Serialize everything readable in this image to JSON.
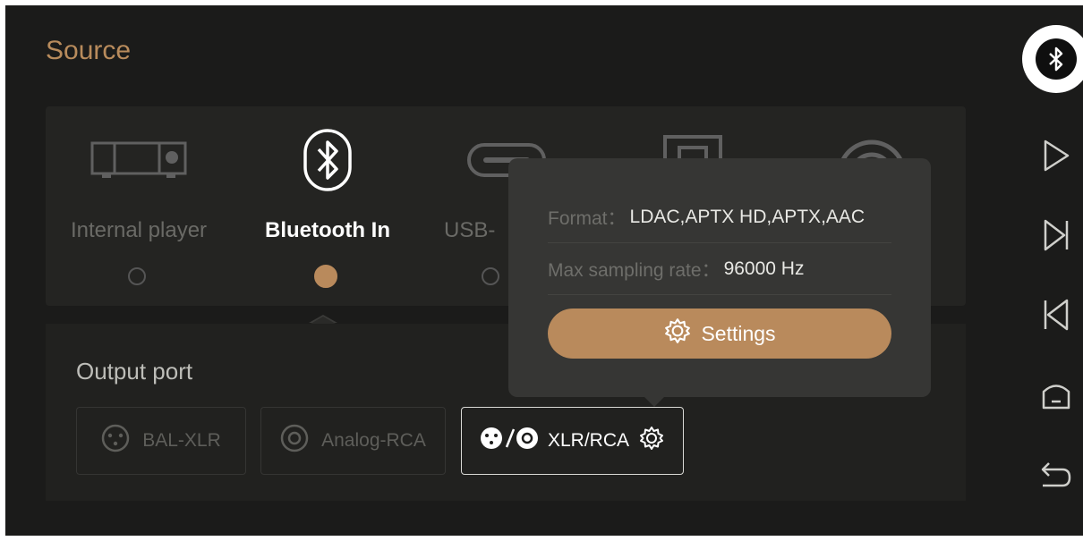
{
  "header": {
    "title": "Source"
  },
  "sources": [
    {
      "label": "Internal player",
      "icon": "player-icon",
      "selected": false
    },
    {
      "label": "Bluetooth In",
      "icon": "bluetooth-icon",
      "selected": true
    },
    {
      "label": "USB-",
      "icon": "usb-c-icon",
      "selected": false
    },
    {
      "label": "",
      "icon": "optical-icon",
      "selected": false
    },
    {
      "label": "",
      "icon": "coaxial-icon",
      "selected": false
    }
  ],
  "output": {
    "title": "Output port",
    "ports": [
      {
        "label": "BAL-XLR",
        "icon": "xlr-icon",
        "selected": false
      },
      {
        "label": "Analog-RCA",
        "icon": "rca-icon",
        "selected": false
      },
      {
        "label": "XLR/RCA",
        "icon": "xlr-rca-icon",
        "selected": true
      }
    ]
  },
  "popup": {
    "format_label": "Format：",
    "format_value": "LDAC,APTX HD,APTX,AAC",
    "rate_label": "Max sampling rate：",
    "rate_value": "96000 Hz",
    "settings_label": "Settings"
  },
  "sidebar": {
    "icons": [
      "bluetooth-icon",
      "play-icon",
      "next-track-icon",
      "previous-track-icon",
      "home-icon",
      "back-icon"
    ]
  },
  "colors": {
    "accent": "#b98a5c",
    "title": "#b88b5c",
    "background": "#1b1b1a"
  }
}
